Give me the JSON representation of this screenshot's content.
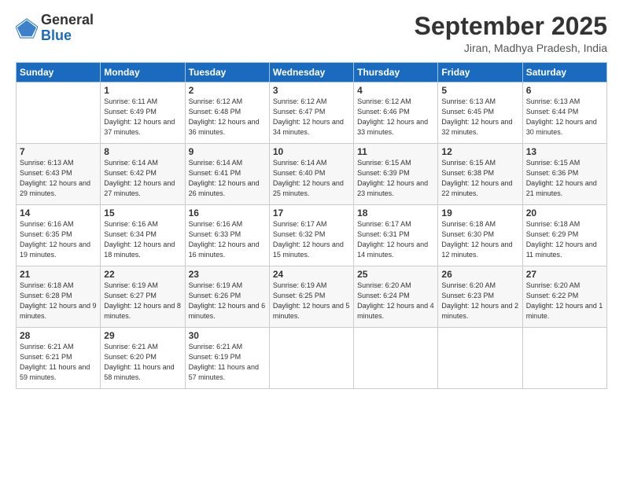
{
  "header": {
    "logo_general": "General",
    "logo_blue": "Blue",
    "month_title": "September 2025",
    "location": "Jiran, Madhya Pradesh, India"
  },
  "days_of_week": [
    "Sunday",
    "Monday",
    "Tuesday",
    "Wednesday",
    "Thursday",
    "Friday",
    "Saturday"
  ],
  "weeks": [
    [
      {
        "day": "",
        "sunrise": "",
        "sunset": "",
        "daylight": ""
      },
      {
        "day": "1",
        "sunrise": "Sunrise: 6:11 AM",
        "sunset": "Sunset: 6:49 PM",
        "daylight": "Daylight: 12 hours and 37 minutes."
      },
      {
        "day": "2",
        "sunrise": "Sunrise: 6:12 AM",
        "sunset": "Sunset: 6:48 PM",
        "daylight": "Daylight: 12 hours and 36 minutes."
      },
      {
        "day": "3",
        "sunrise": "Sunrise: 6:12 AM",
        "sunset": "Sunset: 6:47 PM",
        "daylight": "Daylight: 12 hours and 34 minutes."
      },
      {
        "day": "4",
        "sunrise": "Sunrise: 6:12 AM",
        "sunset": "Sunset: 6:46 PM",
        "daylight": "Daylight: 12 hours and 33 minutes."
      },
      {
        "day": "5",
        "sunrise": "Sunrise: 6:13 AM",
        "sunset": "Sunset: 6:45 PM",
        "daylight": "Daylight: 12 hours and 32 minutes."
      },
      {
        "day": "6",
        "sunrise": "Sunrise: 6:13 AM",
        "sunset": "Sunset: 6:44 PM",
        "daylight": "Daylight: 12 hours and 30 minutes."
      }
    ],
    [
      {
        "day": "7",
        "sunrise": "Sunrise: 6:13 AM",
        "sunset": "Sunset: 6:43 PM",
        "daylight": "Daylight: 12 hours and 29 minutes."
      },
      {
        "day": "8",
        "sunrise": "Sunrise: 6:14 AM",
        "sunset": "Sunset: 6:42 PM",
        "daylight": "Daylight: 12 hours and 27 minutes."
      },
      {
        "day": "9",
        "sunrise": "Sunrise: 6:14 AM",
        "sunset": "Sunset: 6:41 PM",
        "daylight": "Daylight: 12 hours and 26 minutes."
      },
      {
        "day": "10",
        "sunrise": "Sunrise: 6:14 AM",
        "sunset": "Sunset: 6:40 PM",
        "daylight": "Daylight: 12 hours and 25 minutes."
      },
      {
        "day": "11",
        "sunrise": "Sunrise: 6:15 AM",
        "sunset": "Sunset: 6:39 PM",
        "daylight": "Daylight: 12 hours and 23 minutes."
      },
      {
        "day": "12",
        "sunrise": "Sunrise: 6:15 AM",
        "sunset": "Sunset: 6:38 PM",
        "daylight": "Daylight: 12 hours and 22 minutes."
      },
      {
        "day": "13",
        "sunrise": "Sunrise: 6:15 AM",
        "sunset": "Sunset: 6:36 PM",
        "daylight": "Daylight: 12 hours and 21 minutes."
      }
    ],
    [
      {
        "day": "14",
        "sunrise": "Sunrise: 6:16 AM",
        "sunset": "Sunset: 6:35 PM",
        "daylight": "Daylight: 12 hours and 19 minutes."
      },
      {
        "day": "15",
        "sunrise": "Sunrise: 6:16 AM",
        "sunset": "Sunset: 6:34 PM",
        "daylight": "Daylight: 12 hours and 18 minutes."
      },
      {
        "day": "16",
        "sunrise": "Sunrise: 6:16 AM",
        "sunset": "Sunset: 6:33 PM",
        "daylight": "Daylight: 12 hours and 16 minutes."
      },
      {
        "day": "17",
        "sunrise": "Sunrise: 6:17 AM",
        "sunset": "Sunset: 6:32 PM",
        "daylight": "Daylight: 12 hours and 15 minutes."
      },
      {
        "day": "18",
        "sunrise": "Sunrise: 6:17 AM",
        "sunset": "Sunset: 6:31 PM",
        "daylight": "Daylight: 12 hours and 14 minutes."
      },
      {
        "day": "19",
        "sunrise": "Sunrise: 6:18 AM",
        "sunset": "Sunset: 6:30 PM",
        "daylight": "Daylight: 12 hours and 12 minutes."
      },
      {
        "day": "20",
        "sunrise": "Sunrise: 6:18 AM",
        "sunset": "Sunset: 6:29 PM",
        "daylight": "Daylight: 12 hours and 11 minutes."
      }
    ],
    [
      {
        "day": "21",
        "sunrise": "Sunrise: 6:18 AM",
        "sunset": "Sunset: 6:28 PM",
        "daylight": "Daylight: 12 hours and 9 minutes."
      },
      {
        "day": "22",
        "sunrise": "Sunrise: 6:19 AM",
        "sunset": "Sunset: 6:27 PM",
        "daylight": "Daylight: 12 hours and 8 minutes."
      },
      {
        "day": "23",
        "sunrise": "Sunrise: 6:19 AM",
        "sunset": "Sunset: 6:26 PM",
        "daylight": "Daylight: 12 hours and 6 minutes."
      },
      {
        "day": "24",
        "sunrise": "Sunrise: 6:19 AM",
        "sunset": "Sunset: 6:25 PM",
        "daylight": "Daylight: 12 hours and 5 minutes."
      },
      {
        "day": "25",
        "sunrise": "Sunrise: 6:20 AM",
        "sunset": "Sunset: 6:24 PM",
        "daylight": "Daylight: 12 hours and 4 minutes."
      },
      {
        "day": "26",
        "sunrise": "Sunrise: 6:20 AM",
        "sunset": "Sunset: 6:23 PM",
        "daylight": "Daylight: 12 hours and 2 minutes."
      },
      {
        "day": "27",
        "sunrise": "Sunrise: 6:20 AM",
        "sunset": "Sunset: 6:22 PM",
        "daylight": "Daylight: 12 hours and 1 minute."
      }
    ],
    [
      {
        "day": "28",
        "sunrise": "Sunrise: 6:21 AM",
        "sunset": "Sunset: 6:21 PM",
        "daylight": "Daylight: 11 hours and 59 minutes."
      },
      {
        "day": "29",
        "sunrise": "Sunrise: 6:21 AM",
        "sunset": "Sunset: 6:20 PM",
        "daylight": "Daylight: 11 hours and 58 minutes."
      },
      {
        "day": "30",
        "sunrise": "Sunrise: 6:21 AM",
        "sunset": "Sunset: 6:19 PM",
        "daylight": "Daylight: 11 hours and 57 minutes."
      },
      {
        "day": "",
        "sunrise": "",
        "sunset": "",
        "daylight": ""
      },
      {
        "day": "",
        "sunrise": "",
        "sunset": "",
        "daylight": ""
      },
      {
        "day": "",
        "sunrise": "",
        "sunset": "",
        "daylight": ""
      },
      {
        "day": "",
        "sunrise": "",
        "sunset": "",
        "daylight": ""
      }
    ]
  ]
}
